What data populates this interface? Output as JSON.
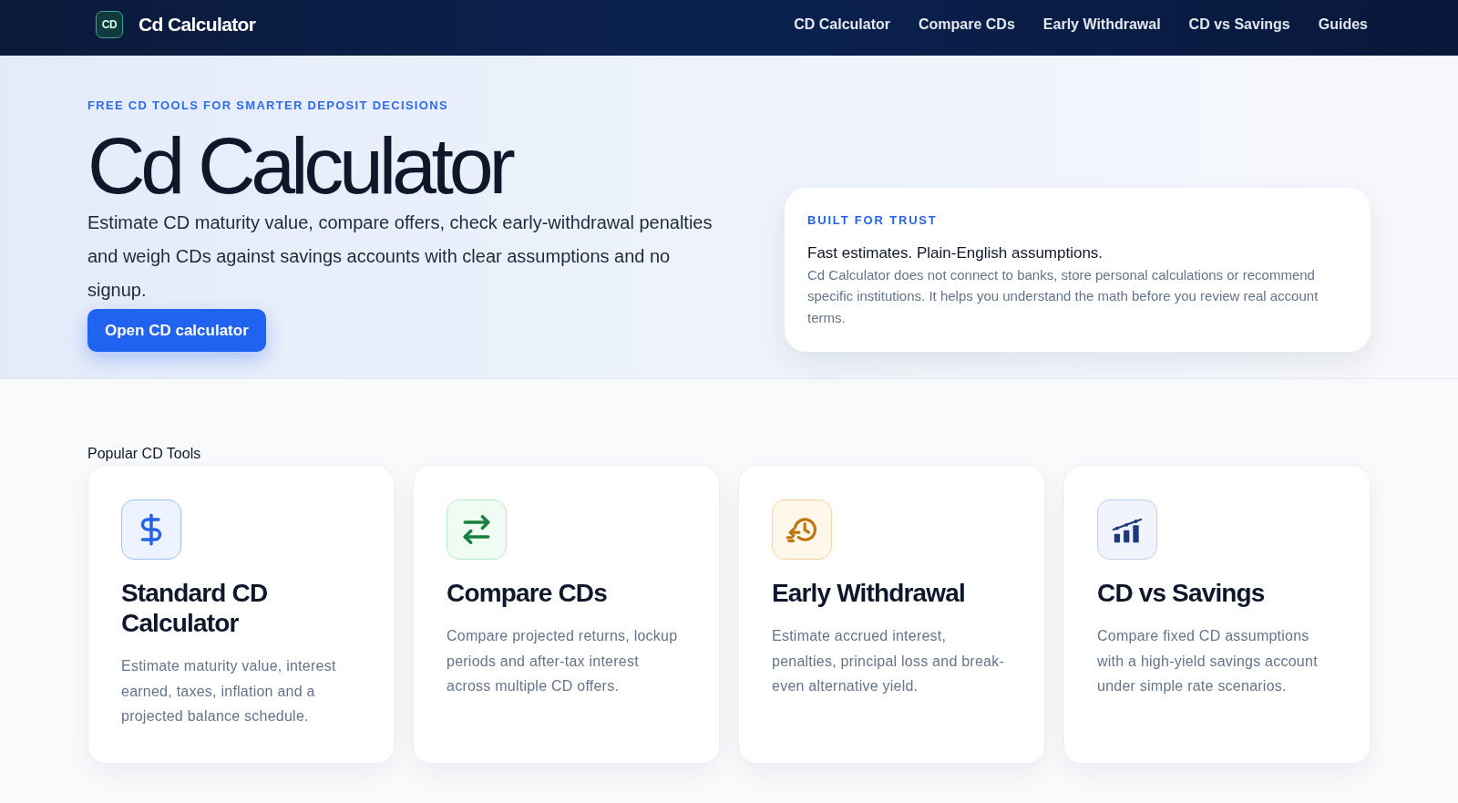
{
  "header": {
    "logo_text": "CD",
    "brand": "Cd Calculator",
    "nav": [
      {
        "label": "CD Calculator"
      },
      {
        "label": "Compare CDs"
      },
      {
        "label": "Early Withdrawal"
      },
      {
        "label": "CD vs Savings"
      },
      {
        "label": "Guides"
      }
    ]
  },
  "hero": {
    "eyebrow": "FREE CD TOOLS FOR SMARTER DEPOSIT DECISIONS",
    "title": "Cd Calculator",
    "lead": "Estimate CD maturity value, compare offers, check early-withdrawal penalties and weigh CDs against savings accounts with clear assumptions and no signup.",
    "button": "Open CD calculator"
  },
  "trust_card": {
    "eyebrow": "BUILT FOR TRUST",
    "heading": "Fast estimates. Plain-English assumptions.",
    "body": "Cd Calculator does not connect to banks, store personal calculations or recommend specific institutions. It helps you understand the math before you review real account terms."
  },
  "tools": {
    "heading": "Popular CD Tools",
    "cards": [
      {
        "kind": "dollar",
        "title": "Standard CD Calculator",
        "description": "Estimate maturity value, interest earned, taxes, inflation and a projected balance schedule."
      },
      {
        "kind": "compare",
        "title": "Compare CDs",
        "description": "Compare projected returns, lockup periods and after-tax interest across multiple CD offers."
      },
      {
        "kind": "withdrawal",
        "title": "Early Withdrawal",
        "description": "Estimate accrued interest, penalties, principal loss and break-even alternative yield."
      },
      {
        "kind": "savings",
        "title": "CD vs Savings",
        "description": "Compare fixed CD assumptions with a high-yield savings account under simple rate scenarios."
      }
    ]
  }
}
